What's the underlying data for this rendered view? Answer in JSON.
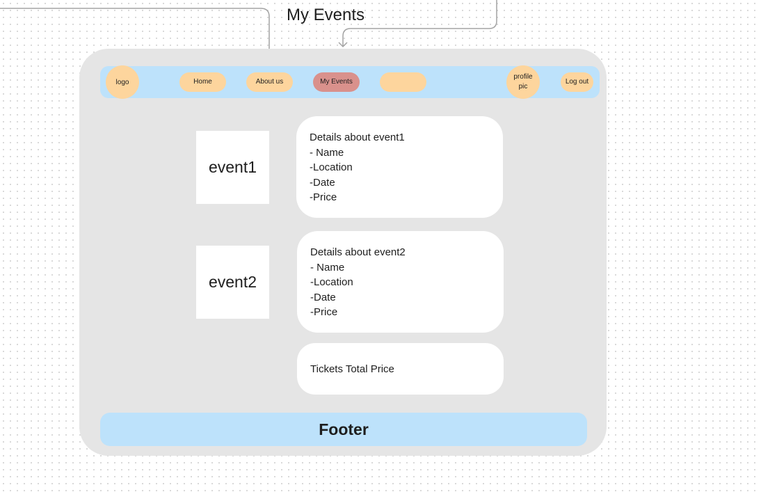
{
  "frame_title": "My Events",
  "navbar": {
    "logo": "logo",
    "home": "Home",
    "about": "About us",
    "my_events": "My Events",
    "blank": "",
    "profile_line1": "profile",
    "profile_line2": "pic",
    "logout": "Log out"
  },
  "events": [
    {
      "thumb": "event1",
      "details": [
        "Details about event1",
        "- Name",
        "-Location",
        "-Date",
        "-Price"
      ]
    },
    {
      "thumb": "event2",
      "details": [
        "Details about event2",
        "- Name",
        "-Location",
        "-Date",
        "-Price"
      ]
    }
  ],
  "total_label": "Tickets Total Price",
  "footer_label": "Footer",
  "colors": {
    "frame": "#e5e5e5",
    "navbar": "#bde2fb",
    "pill": "#fdd59d",
    "active_pill": "#d9918c",
    "card": "#ffffff",
    "connector": "#a3a3a3"
  },
  "icons": [
    "arrow-down-icon"
  ]
}
